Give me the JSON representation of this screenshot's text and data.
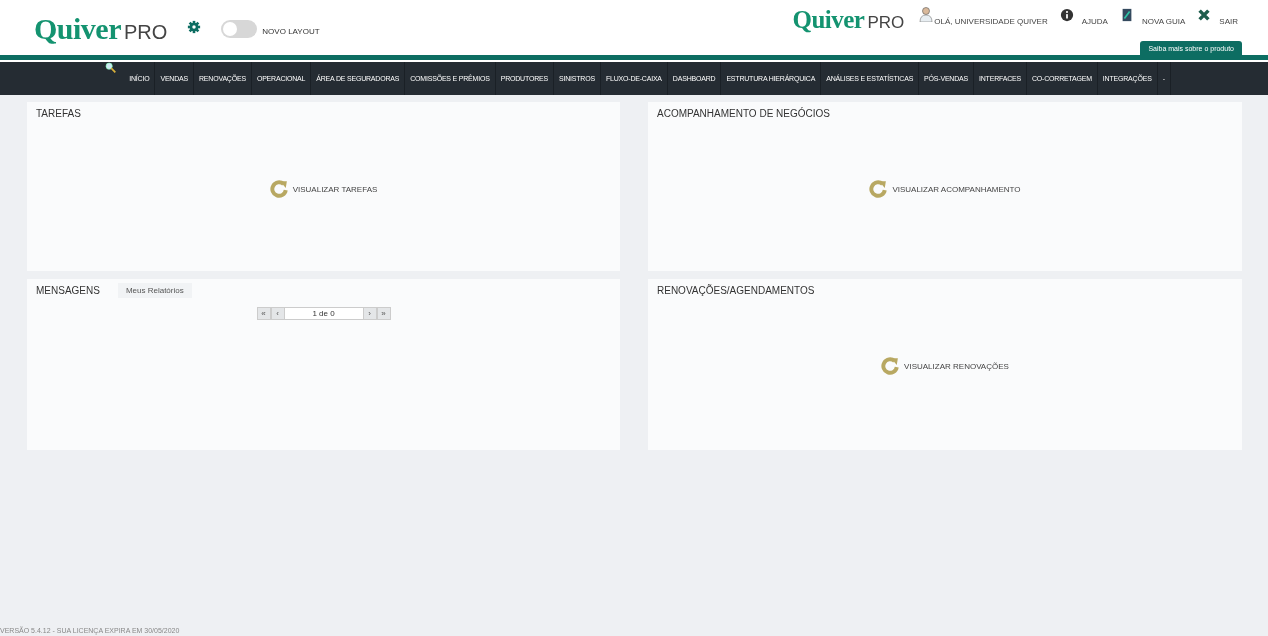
{
  "header": {
    "logo": "Quiver",
    "logo_suffix": "PRO",
    "toggle": {
      "label": "NOVO LAYOUT",
      "on": false
    },
    "right_logo": "Quiver",
    "right_logo_suffix": "PRO",
    "user": "OLÁ, UNIVERSIDADE QUIVER",
    "links": [
      {
        "kind": "info",
        "label": "AJUDA"
      },
      {
        "kind": "tab",
        "label": "NOVA GUIA"
      },
      {
        "kind": "exit",
        "label": "SAIR"
      }
    ],
    "promo": "Saiba mais sobre o produto"
  },
  "nav": {
    "items": [
      "INÍCIO",
      "VENDAS",
      "RENOVAÇÕES",
      "OPERACIONAL",
      "ÁREA DE SEGURADORAS",
      "COMISSÕES E PRÊMIOS",
      "PRODUTORES",
      "SINISTROS",
      "FLUXO-DE-CAIXA",
      "DASHBOARD",
      "ESTRUTURA HIERÁRQUICA",
      "ANÁLISES E ESTATÍSTICAS",
      "PÓS-VENDAS",
      "INTERFACES",
      "CO-CORRETAGEM",
      "INTEGRAÇÕES",
      "-"
    ]
  },
  "panels": [
    {
      "kind": "action",
      "title": "TAREFAS",
      "action": "VISUALIZAR TAREFAS"
    },
    {
      "kind": "action",
      "title": "ACOMPANHAMENTO DE NEGÓCIOS",
      "action": "VISUALIZAR ACOMPANHAMENTO"
    },
    {
      "kind": "pager",
      "title": "MENSAGENS",
      "tab": "Meus Relatórios",
      "pager": {
        "first": "«",
        "prev": "‹",
        "page": "1 de 0",
        "next": "›",
        "last": "»"
      }
    },
    {
      "kind": "action",
      "title": "RENOVAÇÕES/AGENDAMENTOS",
      "action": "VISUALIZAR RENOVAÇÕES"
    }
  ],
  "footer": "VERSÃO 5.4.12 - SUA LICENÇA EXPIRA EM 30/05/2020"
}
